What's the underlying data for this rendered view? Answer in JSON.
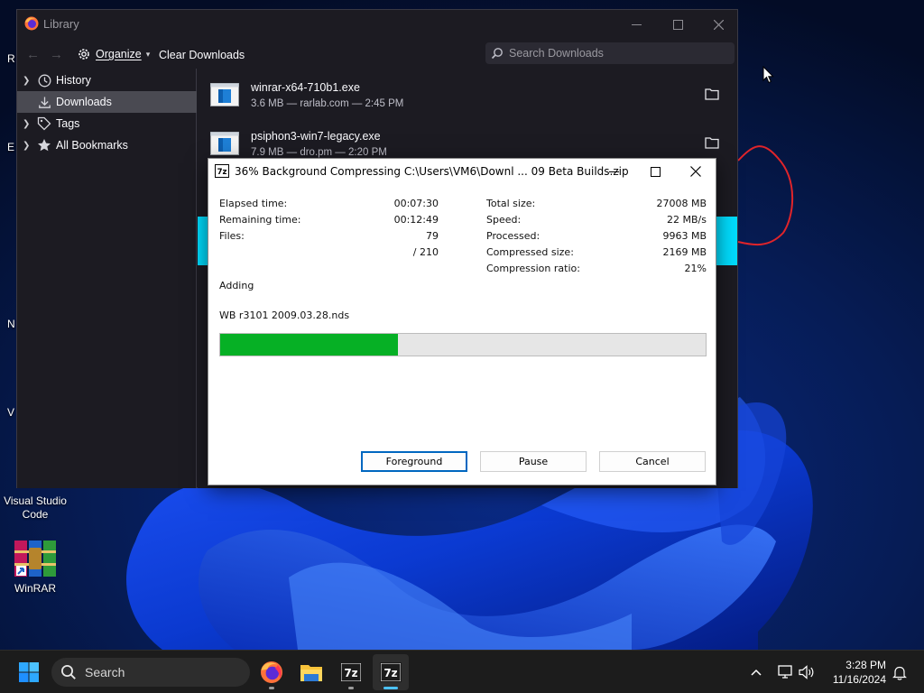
{
  "library": {
    "title": "Library",
    "toolbar": {
      "organize_label": "Organize",
      "organize_caret": "▾",
      "clear_downloads_label": "Clear Downloads"
    },
    "search": {
      "placeholder": "Search Downloads"
    },
    "sidebar": {
      "items": [
        {
          "label": "History",
          "icon": "clock-icon",
          "selected": false
        },
        {
          "label": "Downloads",
          "icon": "download-arrow-icon",
          "selected": true
        },
        {
          "label": "Tags",
          "icon": "tag-icon",
          "selected": false
        },
        {
          "label": "All Bookmarks",
          "icon": "star-icon",
          "selected": false
        }
      ]
    },
    "downloads": [
      {
        "name": "winrar-x64-710b1.exe",
        "meta": "3.6 MB — rarlab.com — 2:45 PM"
      },
      {
        "name": "psiphon3-win7-legacy.exe",
        "meta": "7.9 MB — dro.pm — 2:20 PM"
      }
    ]
  },
  "zip_dialog": {
    "title": "36% Background Compressing C:\\Users\\VM6\\Downl ... 09 Beta Builds.zip",
    "progress_fraction": 0.366,
    "left_stats": [
      {
        "label": "Elapsed time:",
        "value": "00:07:30"
      },
      {
        "label": "Remaining time:",
        "value": "00:12:49"
      },
      {
        "label": "Files:",
        "value": "79"
      },
      {
        "label": "",
        "value": "/ 210"
      }
    ],
    "right_stats": [
      {
        "label": "Total size:",
        "value": "27008 MB"
      },
      {
        "label": "Speed:",
        "value": "22 MB/s"
      },
      {
        "label": "Processed:",
        "value": "9963 MB"
      },
      {
        "label": "Compressed size:",
        "value": "2169 MB"
      },
      {
        "label": "Compression ratio:",
        "value": "21%"
      }
    ],
    "status_text": "Adding",
    "current_file": "WB r3101 2009.03.28.nds",
    "buttons": {
      "foreground": "Foreground",
      "pause": "Pause",
      "cancel": "Cancel"
    }
  },
  "desktop": {
    "icons": [
      {
        "label": "Visual Studio Code"
      },
      {
        "label": "WinRAR"
      }
    ],
    "partial_labels": [
      "R",
      "E",
      "N",
      "V"
    ]
  },
  "taskbar": {
    "search_placeholder": "Search",
    "apps": [
      "start-icon",
      "firefox-icon",
      "file-explorer-icon",
      "7zip-icon",
      "7zip-icon"
    ],
    "time": "3:28 PM",
    "date": "11/16/2024"
  },
  "colors": {
    "library_bg": "#1c1b22",
    "progress_green": "#06b025",
    "accent_cyan": "#00ddff",
    "taskbar_bg": "#1c1c1c"
  }
}
